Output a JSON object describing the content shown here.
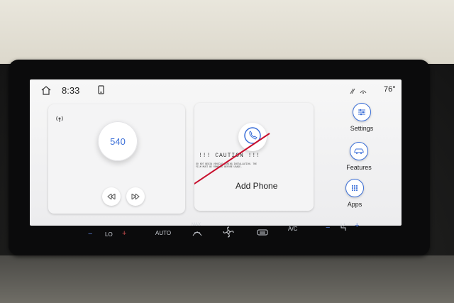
{
  "statusbar": {
    "time": "8:33",
    "temperature": "76°",
    "icons": [
      "home-icon",
      "phone-icon",
      "signal-icon"
    ]
  },
  "radio": {
    "station": "540",
    "icons": [
      "antenna-icon",
      "previous-track-icon",
      "next-track-icon"
    ]
  },
  "phone": {
    "caution_title": "!!! CAUTION !!!",
    "caution_text": "DO NOT BEGIN VEHICLE WIRING INSTALLATION. THE FILM MUST BE REMOVED BEFORE USAGE.",
    "add_phone_label": "Add Phone",
    "icon": "phone-icon"
  },
  "sidebar": {
    "items": [
      {
        "label": "Settings",
        "icon": "sliders-icon"
      },
      {
        "label": "Features",
        "icon": "car-icon"
      },
      {
        "label": "Apps",
        "icon": "grid-icon"
      }
    ]
  },
  "climate": {
    "left_minus": "−",
    "left_temp": "LO",
    "left_plus": "+",
    "auto": "AUTO",
    "max_defrost": "MAX",
    "ac": "A/C",
    "right_minus": "−",
    "right_plus": "+"
  },
  "colors": {
    "accent": "#3b6fd8",
    "screen_bg": "#f2f2f3",
    "bezel": "#0b0b0c",
    "sticker_line": "#c8102e"
  }
}
